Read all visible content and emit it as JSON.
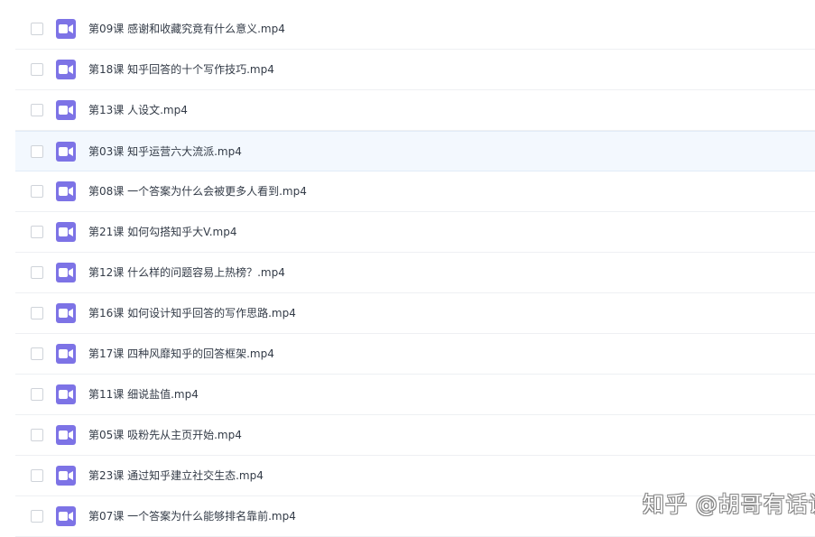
{
  "files": [
    {
      "name": "第09课 感谢和收藏究竟有什么意义.mp4",
      "type": "video",
      "checked": false
    },
    {
      "name": "第18课 知乎回答的十个写作技巧.mp4",
      "type": "video",
      "checked": false
    },
    {
      "name": "第13课 人设文.mp4",
      "type": "video",
      "checked": false
    },
    {
      "name": "第03课 知乎运营六大流派.mp4",
      "type": "video",
      "checked": false,
      "hover": true
    },
    {
      "name": "第08课 一个答案为什么会被更多人看到.mp4",
      "type": "video",
      "checked": false
    },
    {
      "name": "第21课 如何勾搭知乎大V.mp4",
      "type": "video",
      "checked": false
    },
    {
      "name": "第12课 什么样的问题容易上热榜？.mp4",
      "type": "video",
      "checked": false
    },
    {
      "name": "第16课 如何设计知乎回答的写作思路.mp4",
      "type": "video",
      "checked": false
    },
    {
      "name": "第17课 四种风靡知乎的回答框架.mp4",
      "type": "video",
      "checked": false
    },
    {
      "name": "第11课 细说盐值.mp4",
      "type": "video",
      "checked": false
    },
    {
      "name": "第05课 吸粉先从主页开始.mp4",
      "type": "video",
      "checked": false
    },
    {
      "name": "第23课 通过知乎建立社交生态.mp4",
      "type": "video",
      "checked": false
    },
    {
      "name": "第07课 一个答案为什么能够排名靠前.mp4",
      "type": "video",
      "checked": false
    }
  ],
  "icon": {
    "name": "video-file-icon",
    "color": "#7d73e6"
  },
  "watermark": {
    "text": "知乎 @胡哥有话说"
  },
  "colors": {
    "hover_row": "#f3f8fe",
    "divider": "#eef0f3",
    "text": "#333b47"
  }
}
